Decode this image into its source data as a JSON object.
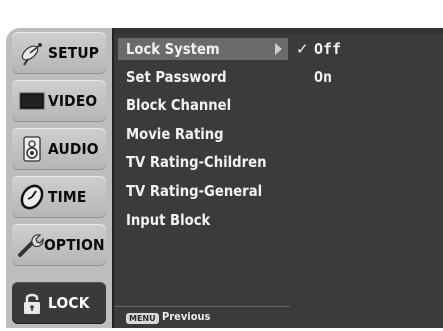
{
  "tabs": [
    {
      "label": "SETUP",
      "icon": "satellite-dish-icon",
      "active": false
    },
    {
      "label": "VIDEO",
      "icon": "tv-screen-icon",
      "active": false
    },
    {
      "label": "AUDIO",
      "icon": "speaker-icon",
      "active": false
    },
    {
      "label": "TIME",
      "icon": "clock-icon",
      "active": false
    },
    {
      "label": "OPTION",
      "icon": "wrench-icon",
      "active": false
    },
    {
      "label": "LOCK",
      "icon": "padlock-icon",
      "active": true
    }
  ],
  "submenu": {
    "items": [
      {
        "label": "Lock System",
        "selected": true
      },
      {
        "label": "Set Password"
      },
      {
        "label": "Block Channel"
      },
      {
        "label": "Movie Rating"
      },
      {
        "label": "TV Rating-Children"
      },
      {
        "label": "TV Rating-General"
      },
      {
        "label": "Input Block"
      }
    ],
    "footer_key": "MENU",
    "footer_label": "Previous"
  },
  "values": {
    "items": [
      {
        "label": "Off",
        "checked": true,
        "check_glyph": "✓"
      },
      {
        "label": "On",
        "checked": false,
        "check_glyph": ""
      }
    ]
  },
  "colors": {
    "panel": "#3b3b3b",
    "tab": "#bdbdbd",
    "active_tab": "#3a3a3a",
    "highlight": "#6b6b6b"
  }
}
